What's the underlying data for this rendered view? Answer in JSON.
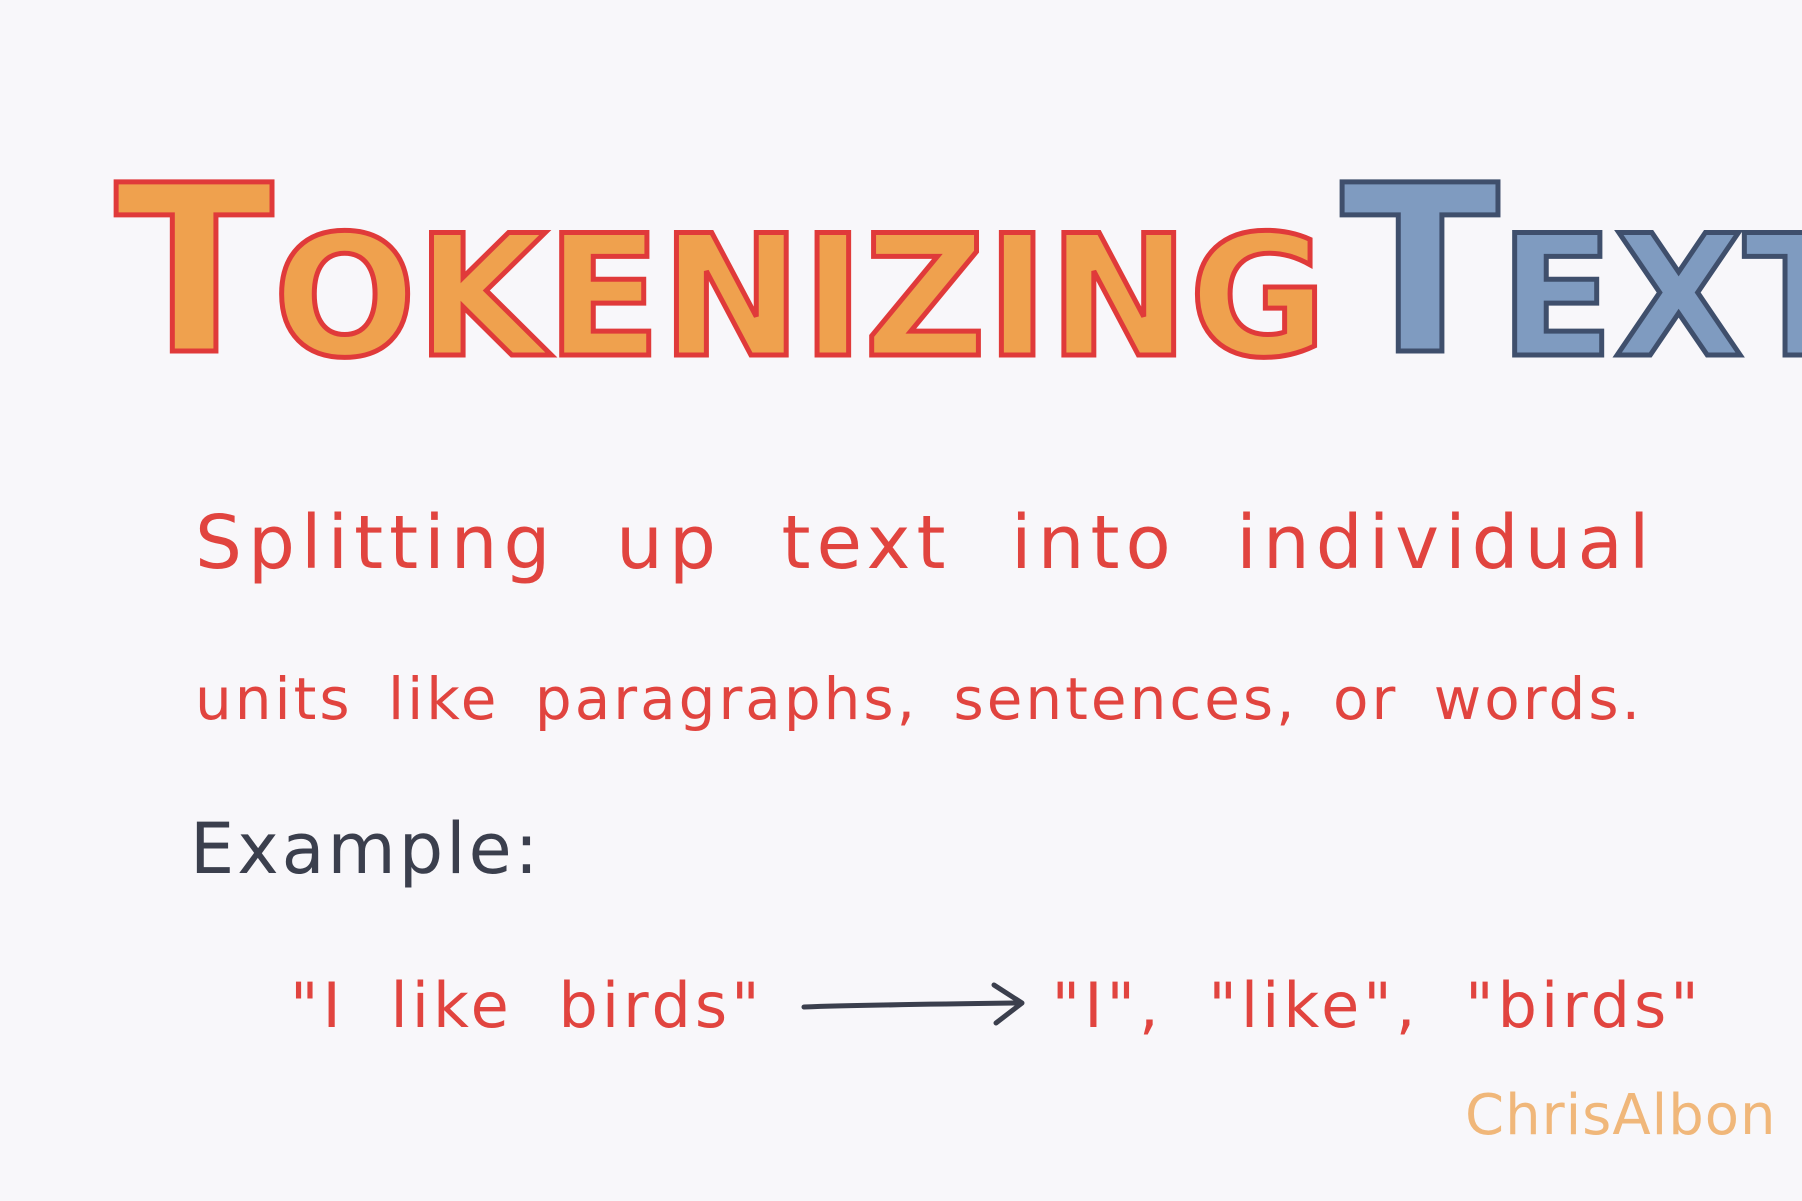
{
  "title": {
    "word1": {
      "initial": "T",
      "rest": "OKENIZING"
    },
    "word2": {
      "initial": "T",
      "rest": "EXT"
    },
    "colors": {
      "word1_fill": "#efa14e",
      "word1_outline": "#e03a3a",
      "word2_fill": "#7f9bc0",
      "word2_outline": "#3f4f6c"
    }
  },
  "definition": {
    "line1": "Splitting up text into individual",
    "line2": "units like paragraphs, sentences, or words.",
    "color": "#e1443f"
  },
  "example": {
    "label": "Example:",
    "input": "\"I like birds\"",
    "arrow_icon": "right-arrow-icon",
    "output": "\"I\", \"like\", \"birds\""
  },
  "signature": {
    "text": "ChrisAlbon",
    "color": "#f0b77a"
  }
}
